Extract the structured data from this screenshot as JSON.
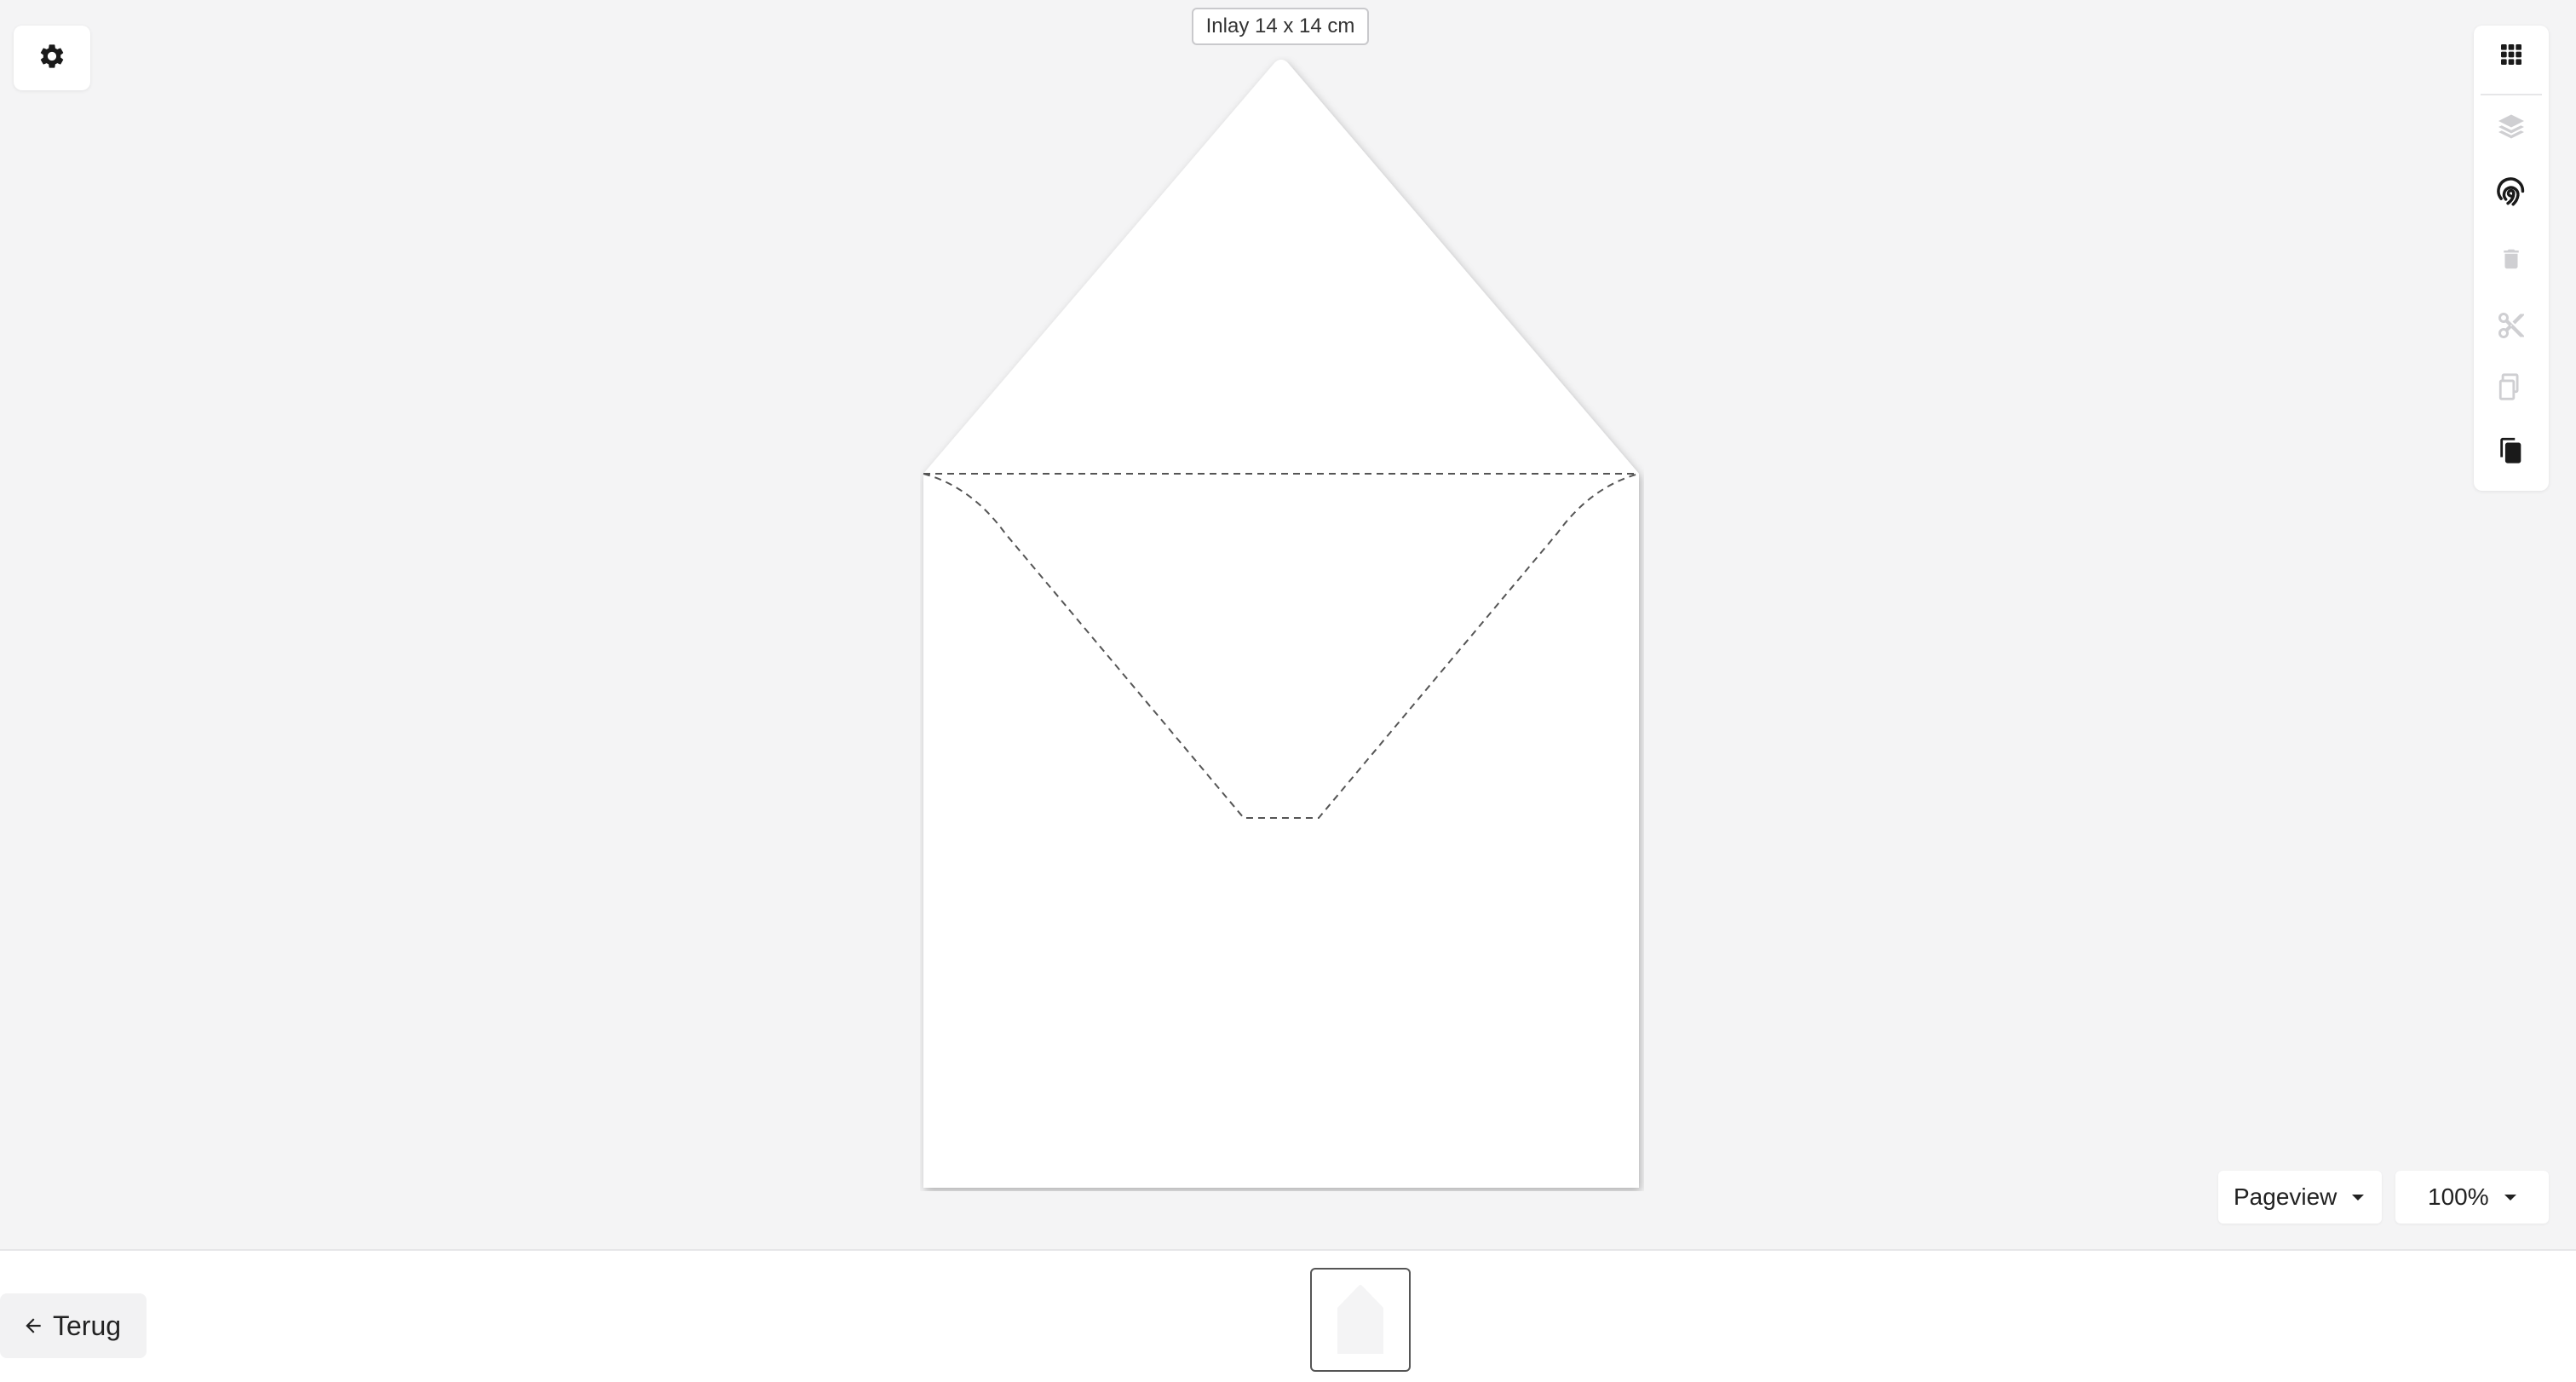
{
  "canvas": {
    "size_label": "Inlay 14 x 14 cm"
  },
  "toolbar": {
    "settings_icon": "gear-icon",
    "tools": [
      {
        "name": "apps-grid-icon",
        "enabled": true
      },
      {
        "name": "layers-icon",
        "enabled": false
      },
      {
        "name": "fingerprint-icon",
        "enabled": true
      },
      {
        "name": "trash-icon",
        "enabled": false
      },
      {
        "name": "cut-icon",
        "enabled": false
      },
      {
        "name": "copy-icon",
        "enabled": false
      },
      {
        "name": "paste-icon",
        "enabled": true
      }
    ]
  },
  "view": {
    "mode_label": "Pageview",
    "zoom_label": "100%"
  },
  "footer": {
    "back_label": "Terug",
    "page_thumbnail": "envelope-thumbnail"
  },
  "colors": {
    "background": "#f4f4f5",
    "icon_active": "#1a1a1a",
    "icon_disabled": "#cfcfd2",
    "fold_line": "#555555"
  }
}
